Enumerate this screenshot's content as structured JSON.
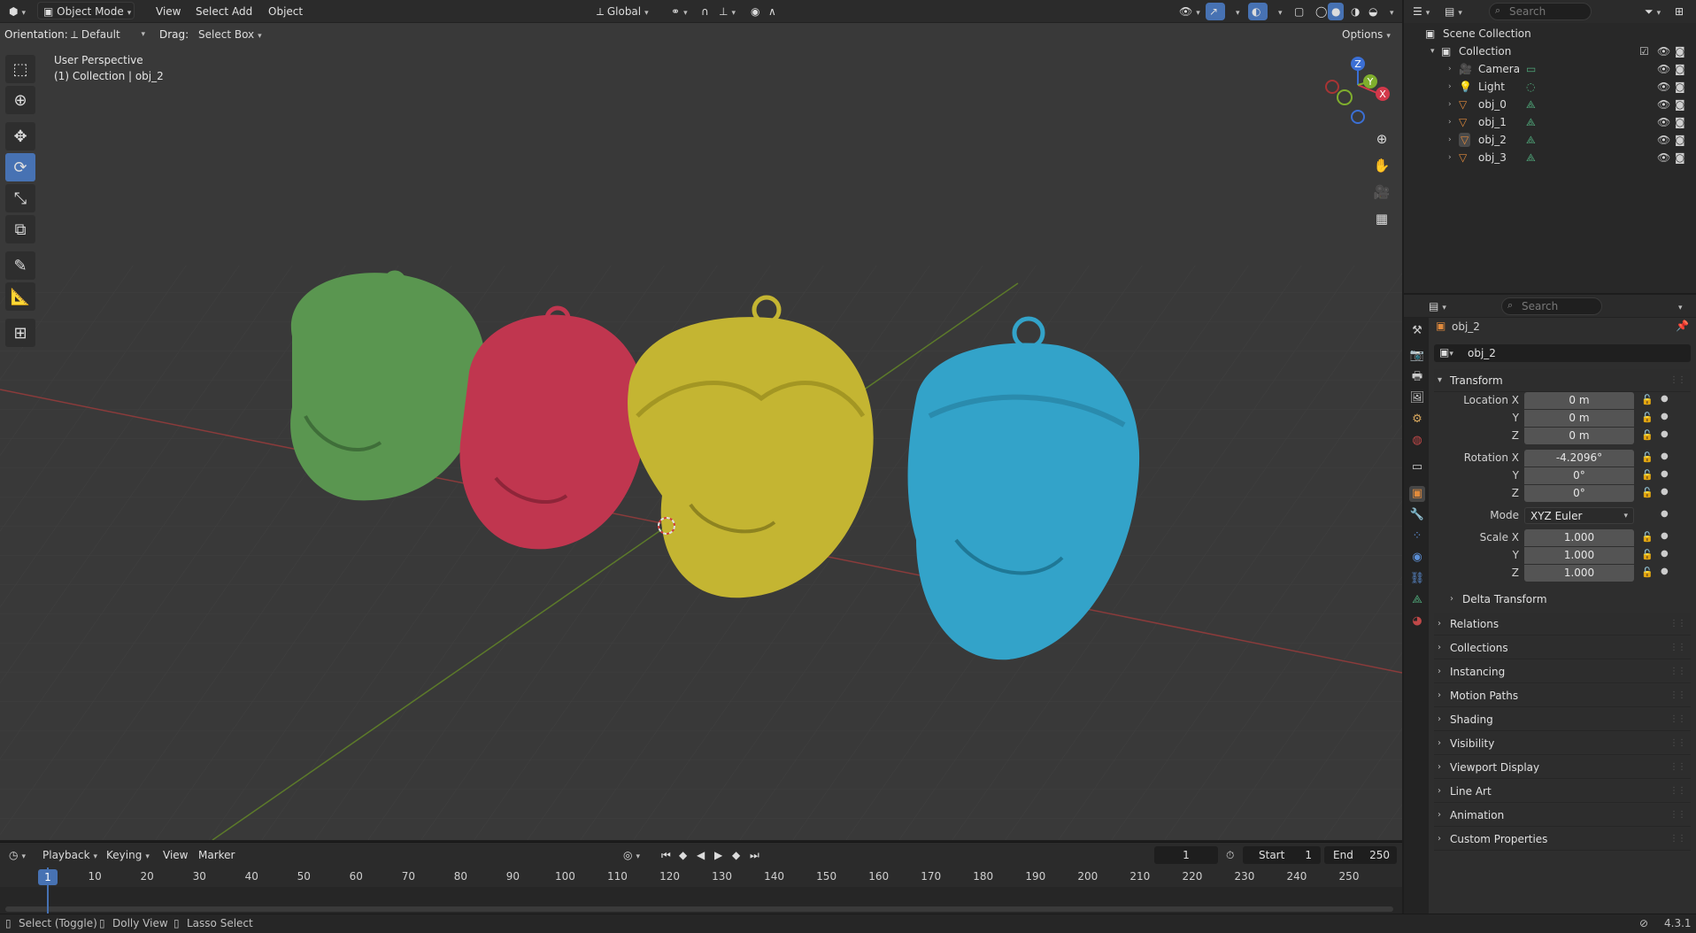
{
  "header": {
    "editor_icon": "cube-editor-icon",
    "mode": "Object Mode",
    "menus": [
      "View",
      "Select",
      "Add",
      "Object"
    ],
    "transform_orientation": "Global",
    "options_label": "Options"
  },
  "tool_settings": {
    "orientation_label": "Orientation:",
    "orientation_value": "Default",
    "drag_label": "Drag:",
    "drag_value": "Select Box"
  },
  "viewport": {
    "perspective": "User Perspective",
    "collection_info": "(1) Collection | obj_2",
    "gizmo": {
      "z": "Z",
      "y": "Y",
      "x": "X"
    },
    "objects": [
      {
        "name": "obj_0",
        "color": "#5a9650"
      },
      {
        "name": "obj_1",
        "color": "#c0364f"
      },
      {
        "name": "obj_2",
        "color": "#c4b532"
      },
      {
        "name": "obj_3",
        "color": "#33a3c9"
      }
    ]
  },
  "timeline": {
    "menus": [
      "Playback",
      "Keying",
      "View",
      "Marker"
    ],
    "current_frame": "1",
    "start_label": "Start",
    "start_value": "1",
    "end_label": "End",
    "end_value": "250",
    "ticks": [
      "1",
      "10",
      "20",
      "30",
      "40",
      "50",
      "60",
      "70",
      "80",
      "90",
      "100",
      "110",
      "120",
      "130",
      "140",
      "150",
      "160",
      "170",
      "180",
      "190",
      "200",
      "210",
      "220",
      "230",
      "240",
      "250"
    ]
  },
  "status": {
    "select": "Select (Toggle)",
    "dolly": "Dolly View",
    "lasso": "Lasso Select",
    "version": "4.3.1"
  },
  "outliner": {
    "search_placeholder": "Search",
    "scene_collection": "Scene Collection",
    "collection": "Collection",
    "items": [
      "Camera",
      "Light",
      "obj_0",
      "obj_1",
      "obj_2",
      "obj_3"
    ]
  },
  "properties": {
    "search_placeholder": "Search",
    "object_name": "obj_2",
    "datablock_name": "obj_2",
    "transform_title": "Transform",
    "location": {
      "label": "Location X",
      "x": "0 m",
      "y": "0 m",
      "z": "0 m"
    },
    "rotation": {
      "label": "Rotation X",
      "x": "-4.2096°",
      "y": "0°",
      "z": "0°"
    },
    "mode_label": "Mode",
    "mode_value": "XYZ Euler",
    "scale": {
      "label": "Scale X",
      "x": "1.000",
      "y": "1.000",
      "z": "1.000"
    },
    "axis_y": "Y",
    "axis_z": "Z",
    "delta_transform": "Delta Transform",
    "panels": [
      "Relations",
      "Collections",
      "Instancing",
      "Motion Paths",
      "Shading",
      "Visibility",
      "Viewport Display",
      "Line Art",
      "Animation",
      "Custom Properties"
    ]
  }
}
